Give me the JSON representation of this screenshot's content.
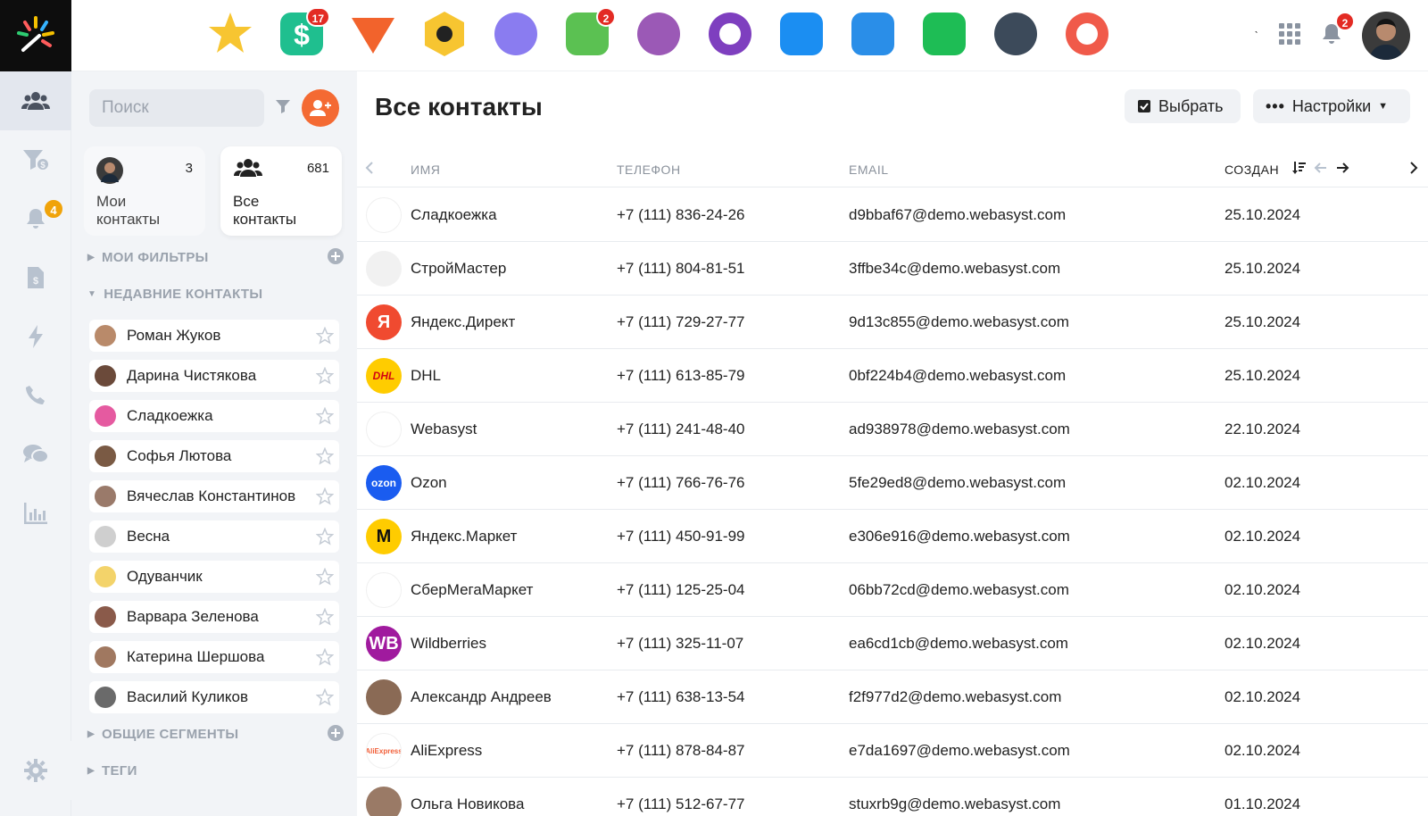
{
  "top_apps": [
    {
      "name": "star-app-icon",
      "color": "#f7c531",
      "badge": ""
    },
    {
      "name": "money-app-icon",
      "color": "#1fbf8f",
      "badge": "17"
    },
    {
      "name": "vivaldi-app-icon",
      "color": "#f2632c",
      "badge": ""
    },
    {
      "name": "hexagon-app-icon",
      "color": "#f7c531",
      "badge": ""
    },
    {
      "name": "spiral-app-icon",
      "color": "#8a7cf0",
      "badge": ""
    },
    {
      "name": "tasks-app-icon",
      "color": "#5bc152",
      "badge": "2"
    },
    {
      "name": "mosaic-app-icon",
      "color": "#9b59b6",
      "badge": ""
    },
    {
      "name": "camera-app-icon",
      "color": "#7e3fbf",
      "badge": ""
    },
    {
      "name": "folder-app-icon",
      "color": "#1b8ef2",
      "badge": ""
    },
    {
      "name": "checklist-app-icon",
      "color": "#2a8ee8",
      "badge": ""
    },
    {
      "name": "chart-check-app-icon",
      "color": "#1ebd55",
      "badge": ""
    },
    {
      "name": "compass-app-icon",
      "color": "#3c4a5a",
      "badge": ""
    },
    {
      "name": "lifebuoy-app-icon",
      "color": "#f05a4a",
      "badge": ""
    }
  ],
  "notifications_badge": "2",
  "rail": {
    "bell_badge": "4"
  },
  "sidebar": {
    "search_placeholder": "Поиск",
    "my_contacts": {
      "count": "3",
      "label": "Мои контакты"
    },
    "all_contacts": {
      "count": "681",
      "label": "Все контакты"
    },
    "my_filters": "МОИ ФИЛЬТРЫ",
    "recent_title": "НЕДАВНИЕ КОНТАКТЫ",
    "recent": [
      {
        "name": "Роман Жуков",
        "color": "#b98a6a"
      },
      {
        "name": "Дарина Чистякова",
        "color": "#6b4a3a"
      },
      {
        "name": "Сладкоежка",
        "color": "#e55aa0"
      },
      {
        "name": "Софья Лютова",
        "color": "#7a5a44"
      },
      {
        "name": "Вячеслав Константинов",
        "color": "#9a7a6a"
      },
      {
        "name": "Весна",
        "color": "#cfcfcf"
      },
      {
        "name": "Одуванчик",
        "color": "#f3d36a"
      },
      {
        "name": "Варвара Зеленова",
        "color": "#8a5a4a"
      },
      {
        "name": "Катерина Шершова",
        "color": "#a07860"
      },
      {
        "name": "Василий Куликов",
        "color": "#6a6a6a"
      }
    ],
    "common_segments": "ОБЩИЕ СЕГМЕНТЫ",
    "tags": "ТЕГИ"
  },
  "main": {
    "title": "Все контакты",
    "select_button": "Выбрать",
    "settings_button": "Настройки",
    "columns": {
      "name": "ИМЯ",
      "phone": "ТЕЛЕФОН",
      "email": "EMAIL",
      "created": "СОЗДАН"
    },
    "rows": [
      {
        "name": "Сладкоежка",
        "phone": "+7 (111) 836-24-26",
        "email": "d9bbaf67@demo.webasyst.com",
        "created": "25.10.2024",
        "logo_color": "#ffffff",
        "logo_text": "",
        "logo_text_color": "#e55aa0"
      },
      {
        "name": "СтройМастер",
        "phone": "+7 (111) 804-81-51",
        "email": "3ffbe34c@demo.webasyst.com",
        "created": "25.10.2024",
        "logo_color": "#f1f1f1",
        "logo_text": "",
        "logo_text_color": "#555"
      },
      {
        "name": "Яндекс.Директ",
        "phone": "+7 (111) 729-27-77",
        "email": "9d13c855@demo.webasyst.com",
        "created": "25.10.2024",
        "logo_color": "#f04a30",
        "logo_text": "Я",
        "logo_text_color": "#ffffff"
      },
      {
        "name": "DHL",
        "phone": "+7 (111) 613-85-79",
        "email": "0bf224b4@demo.webasyst.com",
        "created": "25.10.2024",
        "logo_color": "#ffcc00",
        "logo_text": "DHL",
        "logo_text_color": "#d40511"
      },
      {
        "name": "Webasyst",
        "phone": "+7 (111) 241-48-40",
        "email": "ad938978@demo.webasyst.com",
        "created": "22.10.2024",
        "logo_color": "#ffffff",
        "logo_text": "",
        "logo_text_color": "#222"
      },
      {
        "name": "Ozon",
        "phone": "+7 (111) 766-76-76",
        "email": "5fe29ed8@demo.webasyst.com",
        "created": "02.10.2024",
        "logo_color": "#1a5cf0",
        "logo_text": "ozon",
        "logo_text_color": "#ffffff"
      },
      {
        "name": "Яндекс.Маркет",
        "phone": "+7 (111) 450-91-99",
        "email": "e306e916@demo.webasyst.com",
        "created": "02.10.2024",
        "logo_color": "#ffcc00",
        "logo_text": "M",
        "logo_text_color": "#111"
      },
      {
        "name": "СберМегаМаркет",
        "phone": "+7 (111) 125-25-04",
        "email": "06bb72cd@demo.webasyst.com",
        "created": "02.10.2024",
        "logo_color": "#ffffff",
        "logo_text": "",
        "logo_text_color": "#6c2bd9"
      },
      {
        "name": "Wildberries",
        "phone": "+7 (111) 325-11-07",
        "email": "ea6cd1cb@demo.webasyst.com",
        "created": "02.10.2024",
        "logo_color": "#a01a9e",
        "logo_text": "WB",
        "logo_text_color": "#ffffff"
      },
      {
        "name": "Александр Андреев",
        "phone": "+7 (111) 638-13-54",
        "email": "f2f977d2@demo.webasyst.com",
        "created": "02.10.2024",
        "logo_color": "#8a6a55",
        "logo_text": "",
        "logo_text_color": "#ffffff"
      },
      {
        "name": "AliExpress",
        "phone": "+7 (111) 878-84-87",
        "email": "e7da1697@demo.webasyst.com",
        "created": "02.10.2024",
        "logo_color": "#ffffff",
        "logo_text": "AliExpress",
        "logo_text_color": "#f2603a"
      },
      {
        "name": "Ольга Новикова",
        "phone": "+7 (111) 512-67-77",
        "email": "stuxrb9g@demo.webasyst.com",
        "created": "01.10.2024",
        "logo_color": "#9a7a66",
        "logo_text": "",
        "logo_text_color": "#ffffff"
      }
    ]
  },
  "colors": {
    "accent": "#f46a33",
    "badge": "#e32b24",
    "rail_badge": "#f0a30a"
  }
}
